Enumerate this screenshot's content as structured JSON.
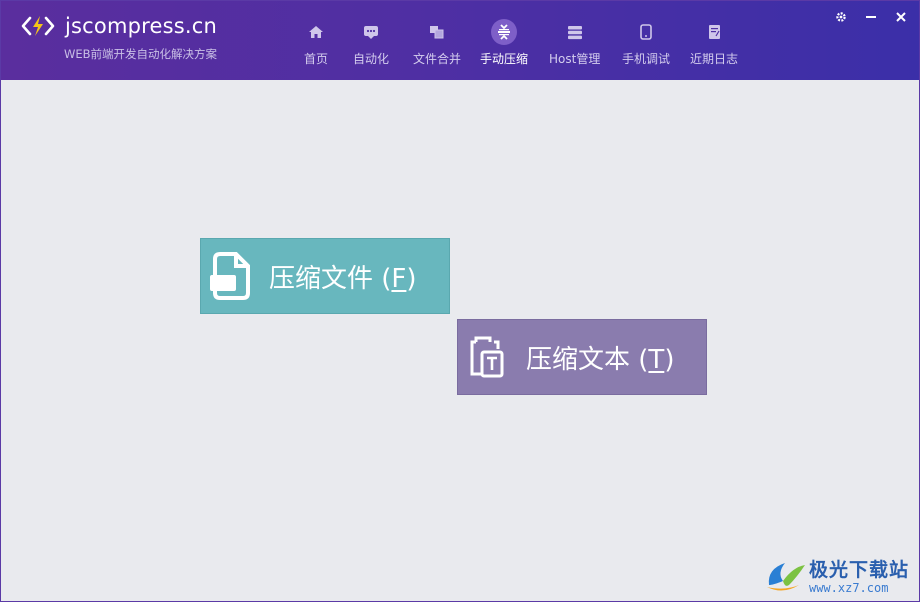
{
  "app": {
    "title": "jscompress.cn",
    "subtitle": "WEB前端开发自动化解决方案"
  },
  "nav": {
    "items": [
      {
        "label": "首页",
        "icon": "home-icon",
        "active": false
      },
      {
        "label": "自动化",
        "icon": "chat-icon",
        "active": false
      },
      {
        "label": "文件合并",
        "icon": "merge-icon",
        "active": false
      },
      {
        "label": "手动压缩",
        "icon": "compress-icon",
        "active": true
      },
      {
        "label": "Host管理",
        "icon": "server-icon",
        "active": false
      },
      {
        "label": "手机调试",
        "icon": "phone-icon",
        "active": false
      },
      {
        "label": "近期日志",
        "icon": "log-icon",
        "active": false
      }
    ]
  },
  "window_controls": {
    "settings": "settings-icon",
    "minimize": "minimize-icon",
    "close": "close-icon"
  },
  "actions": {
    "compress_file": {
      "label_main": "压缩文件 (",
      "hotkey": "F",
      "label_end": ")",
      "color": "#68b7be"
    },
    "compress_text": {
      "label_main": "压缩文本 (",
      "hotkey": "T",
      "label_end": ")",
      "color": "#8a7cae"
    }
  },
  "watermark": {
    "name": "极光下载站",
    "url": "www.xz7.com"
  },
  "colors": {
    "header_start": "#5a2e9e",
    "header_end": "#3b2fa8",
    "background": "#e9eaee"
  }
}
